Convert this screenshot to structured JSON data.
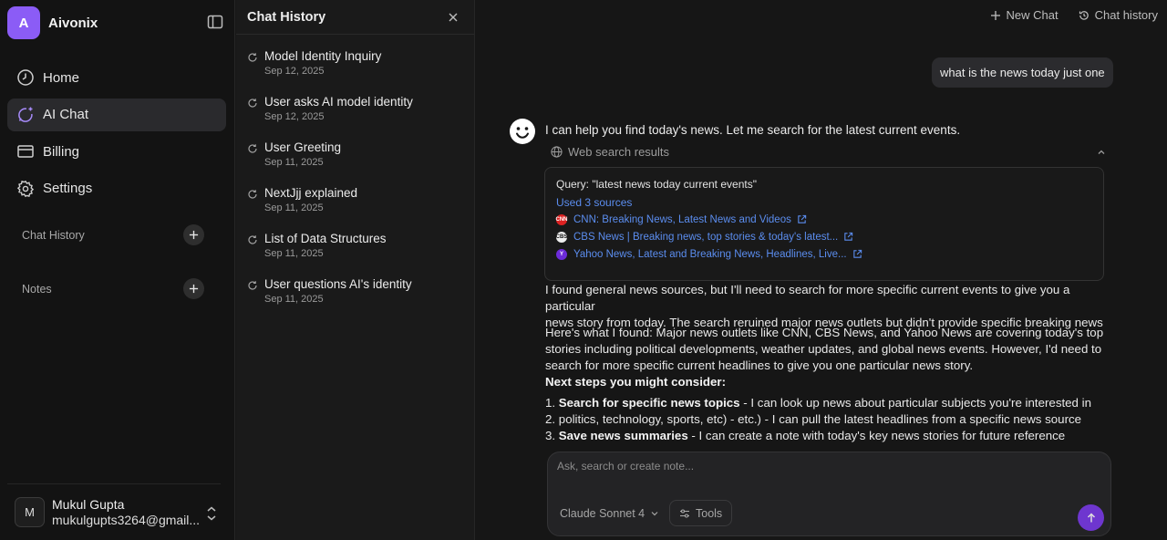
{
  "brand": {
    "logo_letter": "A",
    "name": "Aivonix"
  },
  "sidebar": {
    "nav": [
      {
        "label": "Home",
        "icon": "clock-icon"
      },
      {
        "label": "AI Chat",
        "icon": "chat-sparkle-icon",
        "active": true
      },
      {
        "label": "Billing",
        "icon": "card-icon"
      },
      {
        "label": "Settings",
        "icon": "gear-icon"
      }
    ],
    "sections": {
      "chat_history": "Chat History",
      "notes": "Notes"
    },
    "user": {
      "initial": "M",
      "name": "Mukul Gupta",
      "email": "mukulgupts3264@gmail..."
    }
  },
  "history": {
    "title": "Chat History",
    "items": [
      {
        "title": "Model Identity Inquiry",
        "date": "Sep 12, 2025"
      },
      {
        "title": "User asks AI model identity",
        "date": "Sep 12, 2025"
      },
      {
        "title": "User Greeting",
        "date": "Sep 11, 2025"
      },
      {
        "title": "NextJjj explained",
        "date": "Sep 11, 2025"
      },
      {
        "title": "List of Data Structures",
        "date": "Sep 11, 2025"
      },
      {
        "title": "User questions AI's identity",
        "date": "Sep 11, 2025"
      }
    ]
  },
  "top_actions": {
    "new_chat": "New Chat",
    "chat_history": "Chat history"
  },
  "conversation": {
    "user_message": "what is the news today just one",
    "bot_intro": "I can help you find today's news. Let me search for the latest current events.",
    "web_search": {
      "label": "Web search results",
      "query": "Query: \"latest news today current events\"",
      "used": "Used 3 sources",
      "sources": [
        {
          "title": "CNN: Breaking News, Latest News and Videos",
          "fav": "CNN"
        },
        {
          "title": "CBS News | Breaking news, top stories & today's latest...",
          "fav": "CBS"
        },
        {
          "title": "Yahoo News, Latest and Breaking News, Headlines, Live...",
          "fav": "Y"
        }
      ]
    },
    "para1_line1": "I found general news sources, but I'll need to search for more specific current events to give you a particular",
    "para1_line2": "news story from today. The search reruined major news outlets but didn't provide specific breaking news",
    "para2_line1": "Here's what I found: Major news outlets like CNN, CBS News, and Yahoo News are covering today's top",
    "para2_line2": "stories including political developments, weather updates, and global news events. However, I'd need to",
    "para2_line3": "search for more specific current headlines to give you one particular news story.",
    "next_steps_heading": "Next steps you might consider:",
    "steps": [
      {
        "prefix": "1. ",
        "bold": "Search for specific news topics",
        "rest": " - I can look up news about particular subjects you're interested in"
      },
      {
        "prefix": "2. ",
        "bold": "",
        "rest": "politics, technology, sports, etc) - etc.) - I can pull the latest headlines from a specific news source"
      },
      {
        "prefix": "3. ",
        "bold": "Save news summaries",
        "rest": " - I can create a note with today's key news stories for future reference"
      }
    ]
  },
  "composer": {
    "placeholder": "Ask, search or create note...",
    "model": "Claude Sonnet 4",
    "tools": "Tools"
  },
  "colors": {
    "accent": "#8b5cf6",
    "link": "#5b8def",
    "background": "#161616"
  }
}
